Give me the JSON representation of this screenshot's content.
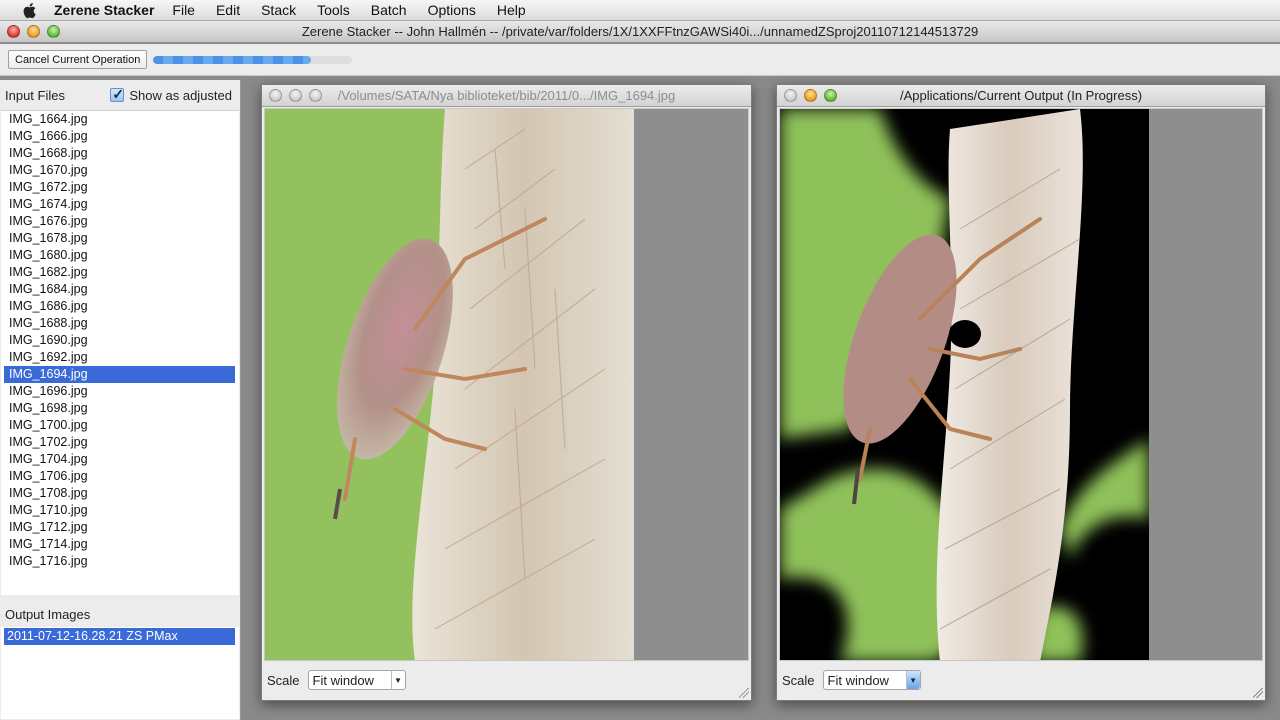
{
  "menubar": {
    "app_name": "Zerene Stacker",
    "items": [
      "File",
      "Edit",
      "Stack",
      "Tools",
      "Batch",
      "Options",
      "Help"
    ]
  },
  "main_window": {
    "title": "Zerene Stacker -- John Hallmén -- /private/var/folders/1X/1XXFFtnzGAWSi40i.../unnamedZSproj20110712144513729"
  },
  "toolbar": {
    "cancel_label": "Cancel Current Operation",
    "progress_fraction": 0.79
  },
  "left_panel": {
    "input_files_label": "Input Files",
    "show_as_adjusted_label": "Show as adjusted",
    "show_as_adjusted_checked": true,
    "files": [
      "IMG_1664.jpg",
      "IMG_1666.jpg",
      "IMG_1668.jpg",
      "IMG_1670.jpg",
      "IMG_1672.jpg",
      "IMG_1674.jpg",
      "IMG_1676.jpg",
      "IMG_1678.jpg",
      "IMG_1680.jpg",
      "IMG_1682.jpg",
      "IMG_1684.jpg",
      "IMG_1686.jpg",
      "IMG_1688.jpg",
      "IMG_1690.jpg",
      "IMG_1692.jpg",
      "IMG_1694.jpg",
      "IMG_1696.jpg",
      "IMG_1698.jpg",
      "IMG_1700.jpg",
      "IMG_1702.jpg",
      "IMG_1704.jpg",
      "IMG_1706.jpg",
      "IMG_1708.jpg",
      "IMG_1710.jpg",
      "IMG_1712.jpg",
      "IMG_1714.jpg",
      "IMG_1716.jpg"
    ],
    "selected_file": "IMG_1694.jpg",
    "output_images_label": "Output Images",
    "output_images": [
      "2011-07-12-16.28.21 ZS PMax"
    ]
  },
  "input_viewer": {
    "title": "/Volumes/SATA/Nya biblioteket/bib/2011/0.../IMG_1694.jpg",
    "scale_label": "Scale",
    "scale_value": "Fit window"
  },
  "output_viewer": {
    "title": "/Applications/Current Output (In Progress)",
    "scale_label": "Scale",
    "scale_value": "Fit window"
  },
  "colors": {
    "selection": "#3a6ad8",
    "background_green": "#93c15e",
    "progress_blue": "#4a93e6"
  }
}
